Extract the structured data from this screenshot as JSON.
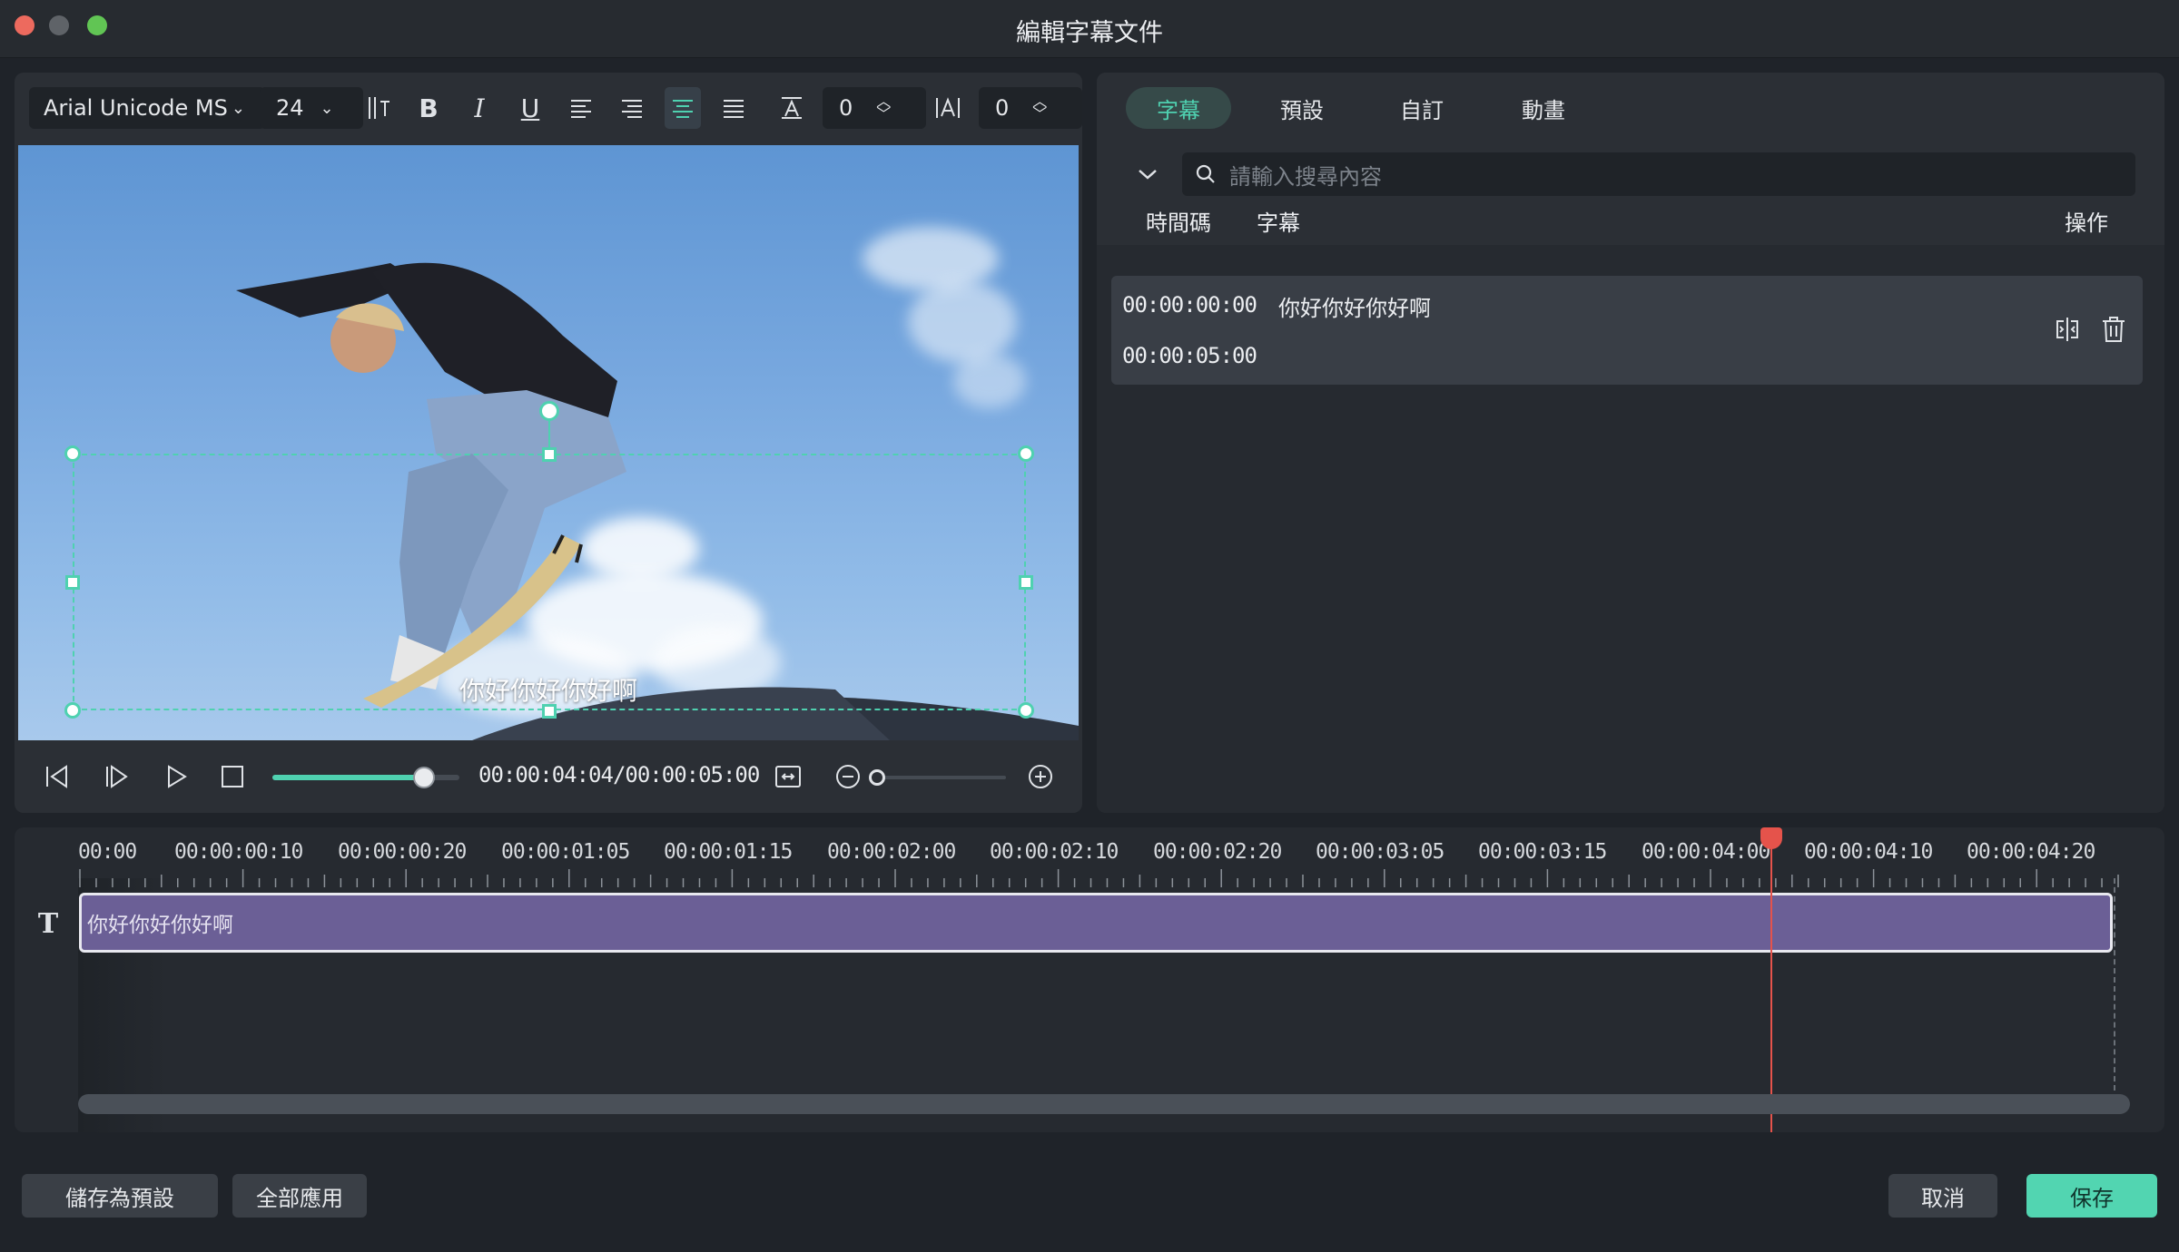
{
  "window": {
    "title": "編輯字幕文件"
  },
  "toolbar": {
    "font_family": "Arial Unicode MS",
    "font_size": "24",
    "bold": "B",
    "italic": "I",
    "underline": "U",
    "char_spacing_value": "0",
    "line_spacing_value": "0"
  },
  "preview": {
    "subtitle_text": "你好你好你好啊"
  },
  "player": {
    "timecode": "00:00:04:04/00:00:05:00",
    "progress": 0.81,
    "zoom_level": 0.0
  },
  "tabs": [
    {
      "label": "字幕",
      "active": true
    },
    {
      "label": "預設",
      "active": false
    },
    {
      "label": "自訂",
      "active": false
    },
    {
      "label": "動畫",
      "active": false
    }
  ],
  "search": {
    "placeholder": "請輸入搜尋內容"
  },
  "table": {
    "headers": {
      "timecode": "時間碼",
      "subtitle": "字幕",
      "actions": "操作"
    },
    "rows": [
      {
        "start": "00:00:00:00",
        "end": "00:00:05:00",
        "text": "你好你好你好啊"
      }
    ]
  },
  "timeline": {
    "ticks": [
      "00:00",
      "00:00:00:10",
      "00:00:00:20",
      "00:00:01:05",
      "00:00:01:15",
      "00:00:02:00",
      "00:00:02:10",
      "00:00:02:20",
      "00:00:03:05",
      "00:00:03:15",
      "00:00:04:00",
      "00:00:04:10",
      "00:00:04:20"
    ],
    "clip_text": "你好你好你好啊",
    "playhead_color": "#e5534b",
    "clip_color": "#6b5f96"
  },
  "footer": {
    "save_preset": "儲存為預設",
    "apply_all": "全部應用",
    "cancel": "取消",
    "save": "保存"
  },
  "colors": {
    "accent": "#4fd1b0",
    "window_bg": "#1f2329",
    "panel_bg": "#2b2f35"
  }
}
